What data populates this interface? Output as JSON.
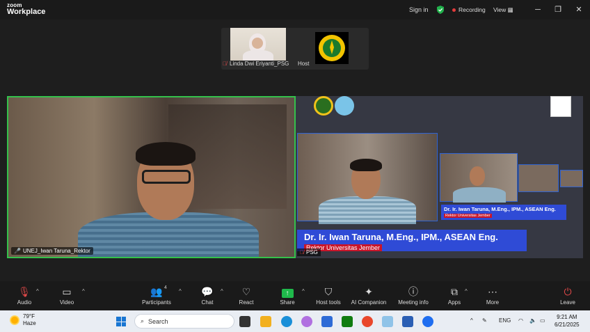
{
  "app": {
    "brand_small": "zoom",
    "brand_large": "Workplace"
  },
  "titlebar": {
    "signin": "Sign in",
    "recording": "Recording",
    "view": "View"
  },
  "gallery": {
    "participant_name": "Linda Dwi Eriyanti_PSG",
    "host_label": "Host"
  },
  "main_tile": {
    "name": "UNEJ_Iwan Taruna_Rektor",
    "border_color": "#34c14b"
  },
  "share_tile": {
    "name": "PSG",
    "caption_title": "Dr. Ir. Iwan Taruna, M.Eng., IPM., ASEAN Eng.",
    "caption_subtitle": "Rektor Universitas Jember",
    "caption_small_title": "Dr. Ir. Iwan Taruna, M.Eng., IPM., ASEAN Eng.",
    "caption_small_subtitle": "Rektor Universitas Jember"
  },
  "toolbar": {
    "audio": "Audio",
    "video": "Video",
    "participants": "Participants",
    "participants_count": "4",
    "chat": "Chat",
    "react": "React",
    "share": "Share",
    "host_tools": "Host tools",
    "ai_companion": "AI Companion",
    "meeting_info": "Meeting info",
    "apps": "Apps",
    "more": "More",
    "leave": "Leave"
  },
  "taskbar": {
    "weather_temp": "79°F",
    "weather_desc": "Haze",
    "search_placeholder": "Search",
    "lang": "ENG",
    "time": "9:21 AM",
    "date": "6/21/2025"
  },
  "colors": {
    "share_green": "#1fb94b",
    "recording_red": "#e23b3b",
    "caption_blue": "#2f4bd6",
    "caption_red": "#c9152a"
  }
}
